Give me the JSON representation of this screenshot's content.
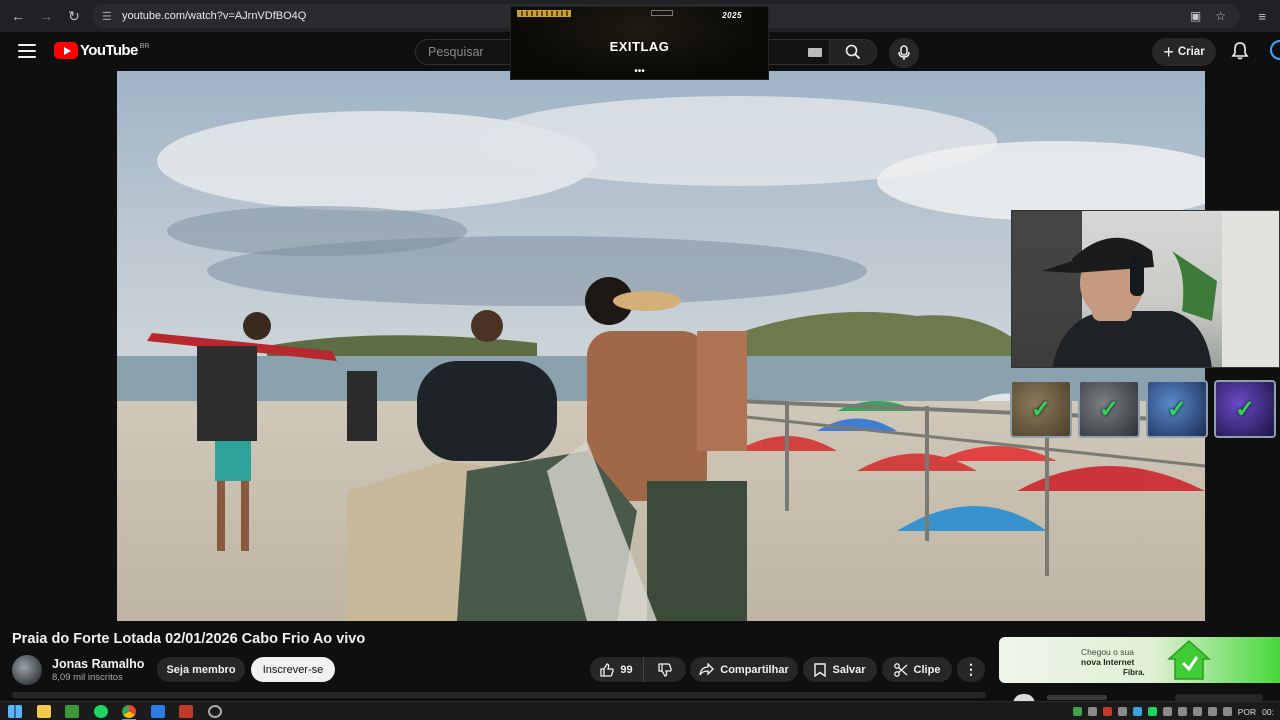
{
  "browser": {
    "url": "youtube.com/watch?v=AJrnVDfBO4Q"
  },
  "header": {
    "logo_text": "YouTube",
    "country_code": "BR",
    "search_placeholder": "Pesquisar",
    "create_label": "Criar"
  },
  "overlay": {
    "brand": "EXITLAG",
    "badge": "2025",
    "dots": "•••"
  },
  "video": {
    "title": "Praia do Forte Lotada 02/01/2026 Cabo Frio Ao vivo"
  },
  "channel": {
    "name": "Jonas Ramalho",
    "subscribers": "8,09 mil inscritos",
    "member_label": "Seja membro",
    "subscribe_label": "Inscrever-se"
  },
  "actions": {
    "likes": "99",
    "share": "Compartilhar",
    "save": "Salvar",
    "clip": "Clipe",
    "more": "⋮"
  },
  "ad": {
    "line1": "Chegou o sua",
    "line2": "nova Internet",
    "line3": "Fibra."
  },
  "taskbar": {
    "language": "POR",
    "clock": "00:"
  },
  "colors": {
    "youtube_red": "#ff0000",
    "background": "#0f0f0f",
    "pill": "#272727",
    "achievement_check": "#32d35a",
    "ad_green": "#47d83c"
  },
  "icons": [
    "back-arrow-icon",
    "forward-arrow-icon",
    "reload-icon",
    "site-settings-icon",
    "install-app-icon",
    "bookmark-star-icon",
    "extensions-menu-icon",
    "hamburger-icon",
    "youtube-logo-icon",
    "keyboard-icon",
    "search-icon",
    "mic-icon",
    "plus-icon",
    "bell-icon",
    "like-icon",
    "dislike-icon",
    "share-icon",
    "save-icon",
    "clip-icon",
    "more-icon"
  ]
}
